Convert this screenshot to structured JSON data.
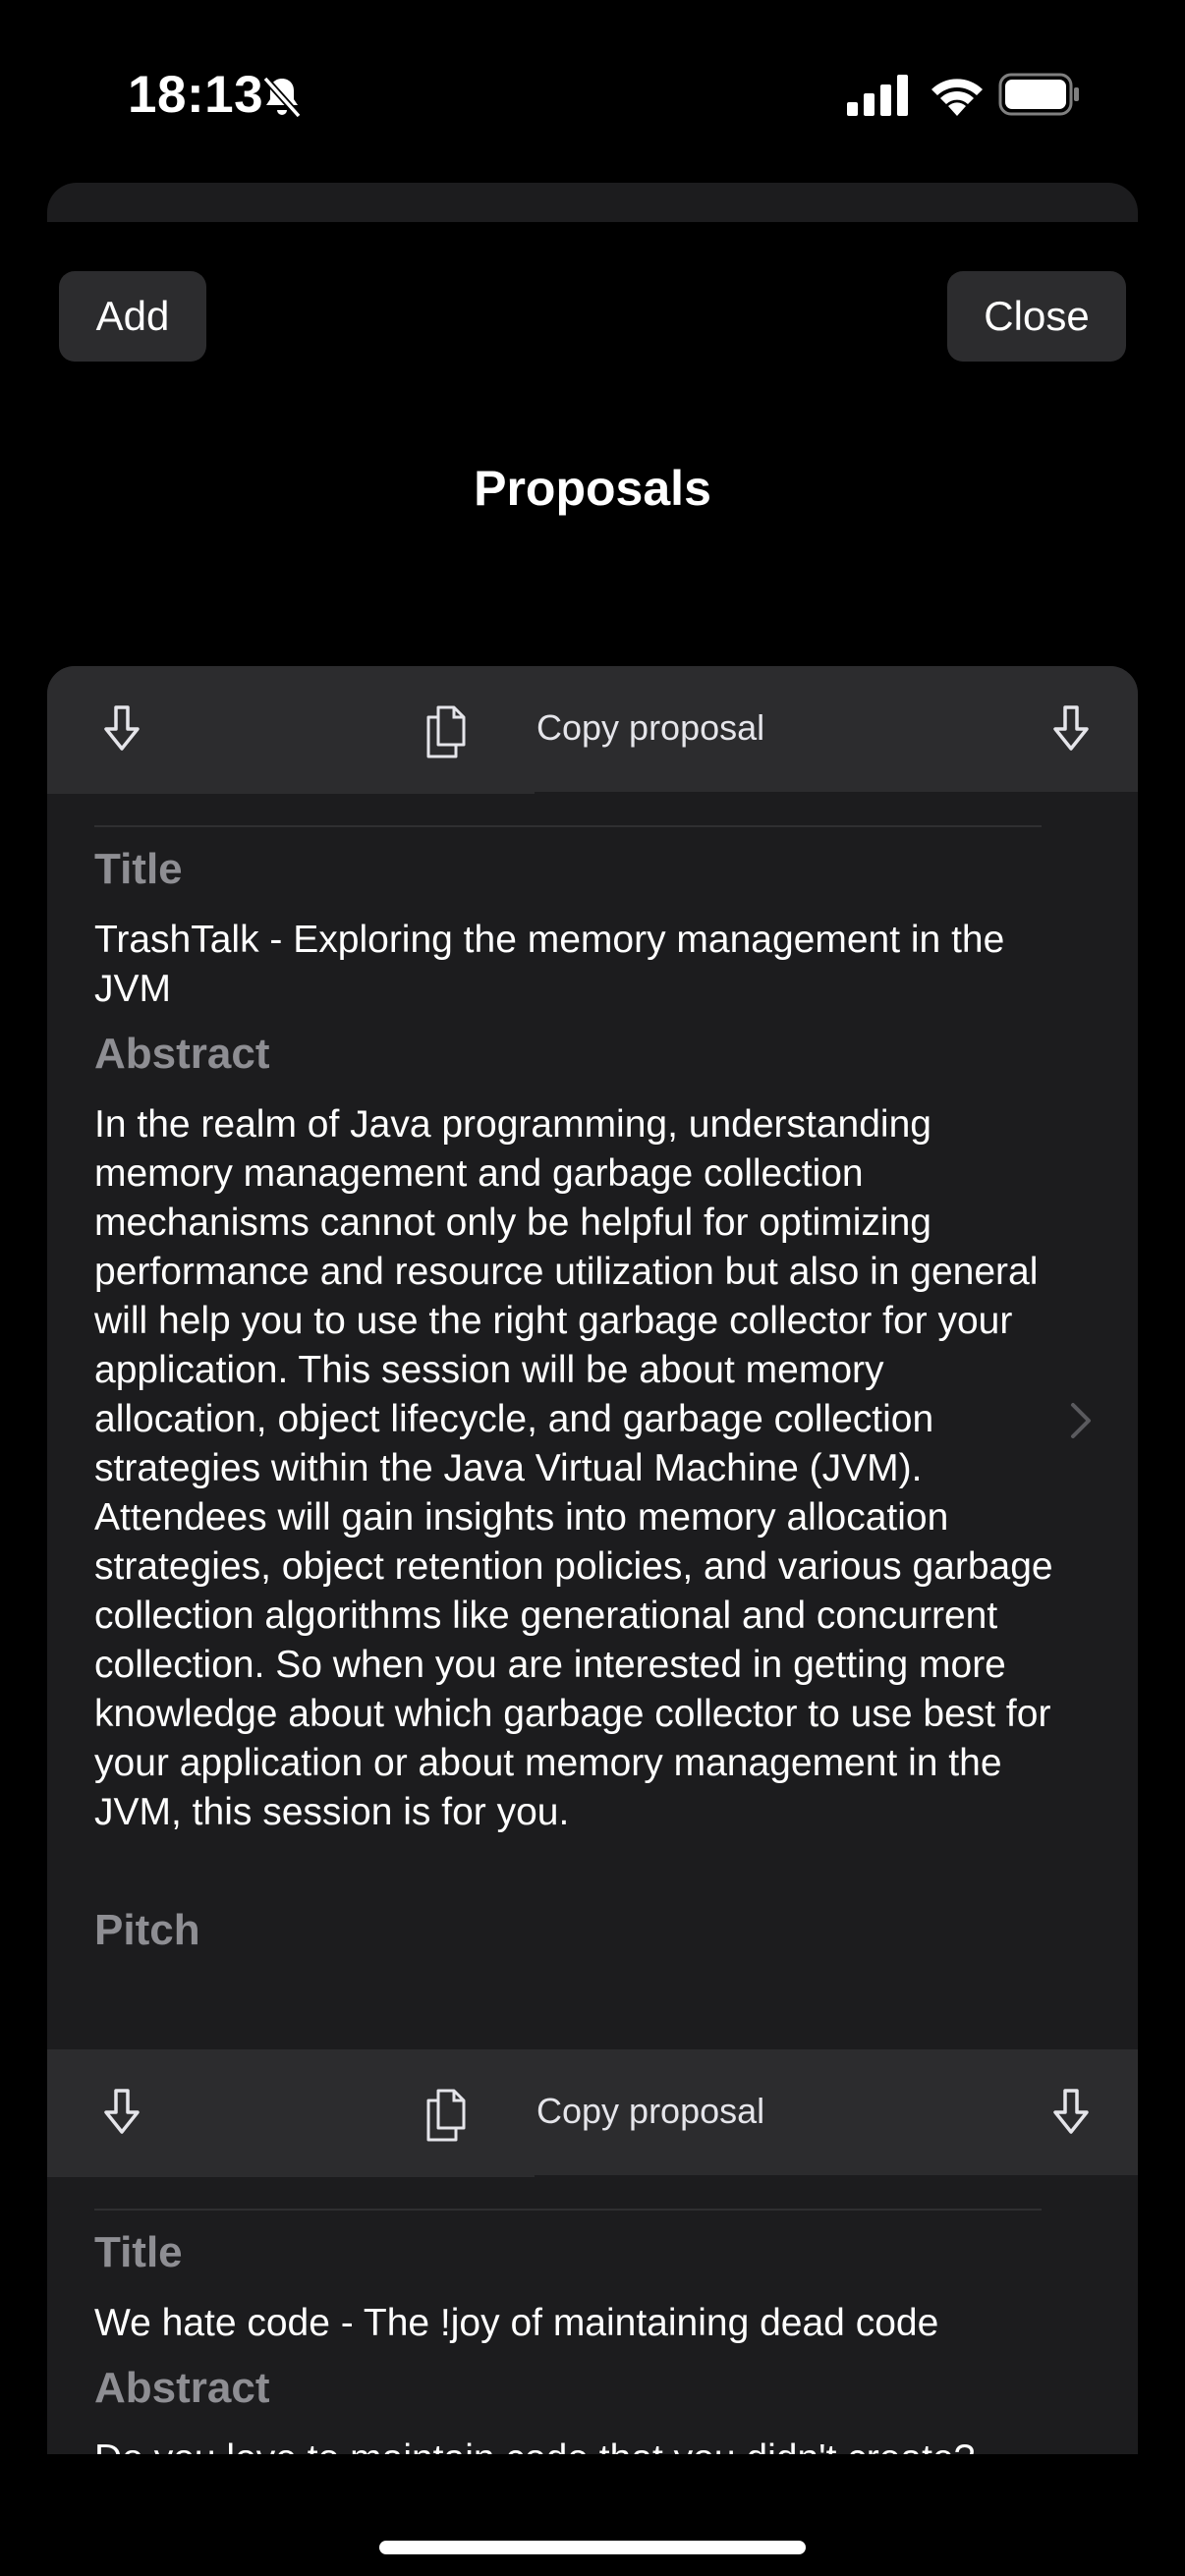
{
  "status_bar": {
    "time": "18:13",
    "icons": [
      "bell-slash-icon",
      "cellular-signal-icon",
      "wifi-icon",
      "battery-icon"
    ]
  },
  "header": {
    "add_label": "Add",
    "close_label": "Close",
    "title": "Proposals"
  },
  "proposals": [
    {
      "copy_label": "Copy proposal",
      "title_label": "Title",
      "title": "TrashTalk - Exploring the memory management in the JVM",
      "abstract_label": "Abstract",
      "abstract": "In the realm of Java programming, understanding memory management and garbage collection mechanisms cannot only be helpful for optimizing performance and resource utilization but also in general will help you to use the right garbage collector for your application. This session will be about memory allocation, object lifecycle, and garbage collection strategies within the Java Virtual Machine (JVM). Attendees will gain insights into memory allocation strategies, object retention policies, and various garbage collection algorithms like generational and concurrent collection. So when you are interested in getting more knowledge about which garbage collector to use best for your application or about memory management in the JVM, this session is for you.",
      "pitch_label": "Pitch"
    },
    {
      "copy_label": "Copy proposal",
      "title_label": "Title",
      "title": "We hate code - The !joy of maintaining dead code",
      "abstract_label": "Abstract",
      "abstract": "Do you love to maintain code that you didn't create?"
    }
  ],
  "colors": {
    "background": "#000000",
    "card": "#1c1c1e",
    "toolbar": "#2c2c2e",
    "button": "#2c2c2e",
    "secondary_text": "#8e8e93"
  }
}
